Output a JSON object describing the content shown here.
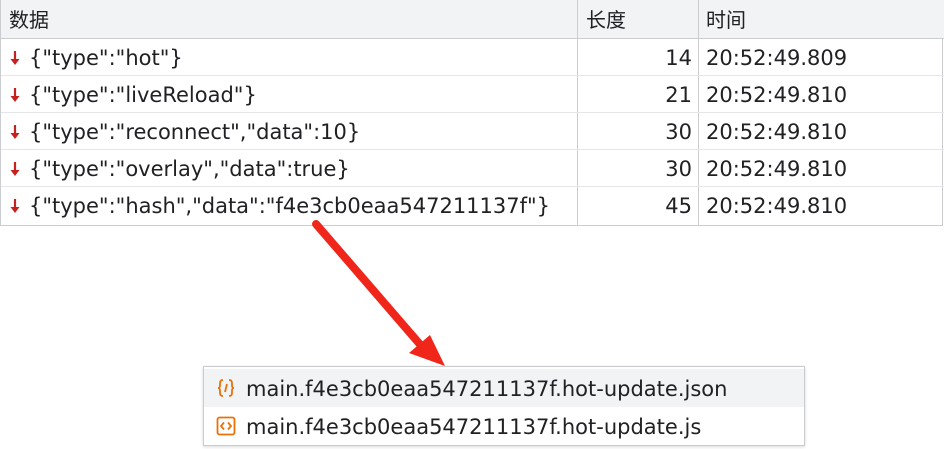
{
  "table": {
    "headers": {
      "data": "数据",
      "length": "长度",
      "time": "时间"
    },
    "rows": [
      {
        "data": "{\"type\":\"hot\"}",
        "length": "14",
        "time": "20:52:49.809"
      },
      {
        "data": "{\"type\":\"liveReload\"}",
        "length": "21",
        "time": "20:52:49.810"
      },
      {
        "data": "{\"type\":\"reconnect\",\"data\":10}",
        "length": "30",
        "time": "20:52:49.810"
      },
      {
        "data": "{\"type\":\"overlay\",\"data\":true}",
        "length": "30",
        "time": "20:52:49.810"
      },
      {
        "data": "{\"type\":\"hash\",\"data\":\"f4e3cb0eaa547211137f\"}",
        "length": "45",
        "time": "20:52:49.810"
      }
    ],
    "row_icon": "received-arrow-down-icon",
    "arrow_color": "#c5221f"
  },
  "annotation": {
    "icon": "red-arrow-annotation",
    "color": "#f0261b"
  },
  "files": [
    {
      "name": "main.f4e3cb0eaa547211137f.hot-update.json",
      "icon": "json-file-icon"
    },
    {
      "name": "main.f4e3cb0eaa547211137f.hot-update.js",
      "icon": "js-file-icon"
    }
  ],
  "colors": {
    "file_icon": "#e8710a",
    "header_bg": "#f1f3f4",
    "border": "#cbcdd1"
  }
}
